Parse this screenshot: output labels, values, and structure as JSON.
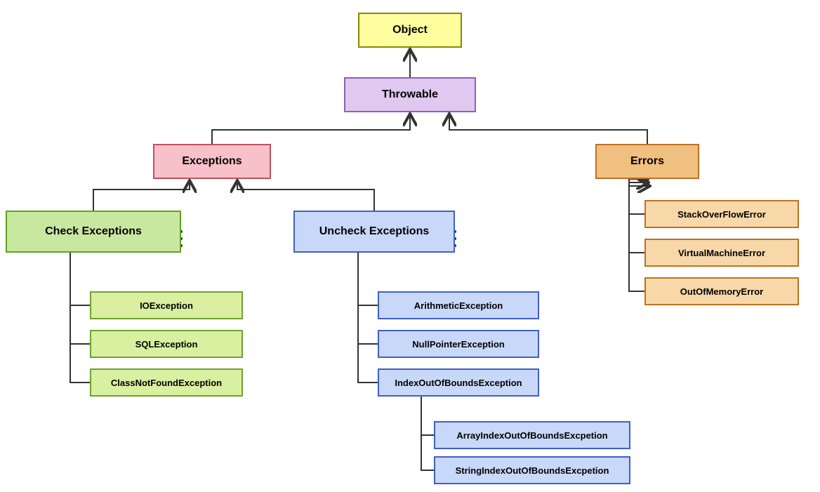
{
  "nodes": {
    "object": "Object",
    "throwable": "Throwable",
    "exceptions": "Exceptions",
    "errors": "Errors",
    "check_exceptions": "Check Exceptions",
    "uncheck_exceptions": "Uncheck Exceptions",
    "ioexception": "IOException",
    "sqlexception": "SQLException",
    "classnotfound": "ClassNotFoundException",
    "arithmetic": "ArithmeticException",
    "nullpointer": "NullPointerException",
    "indexoutofbounds": "IndexOutOfBoundsException",
    "arrayindex": "ArrayIndexOutOfBoundsExcpetion",
    "stringindex": "StringIndexOutOfBoundsExcpetion",
    "stackoverflow": "StackOverFlowError",
    "virtualmachine": "VirtualMachineError",
    "outofmemory": "OutOfMemoryError"
  }
}
